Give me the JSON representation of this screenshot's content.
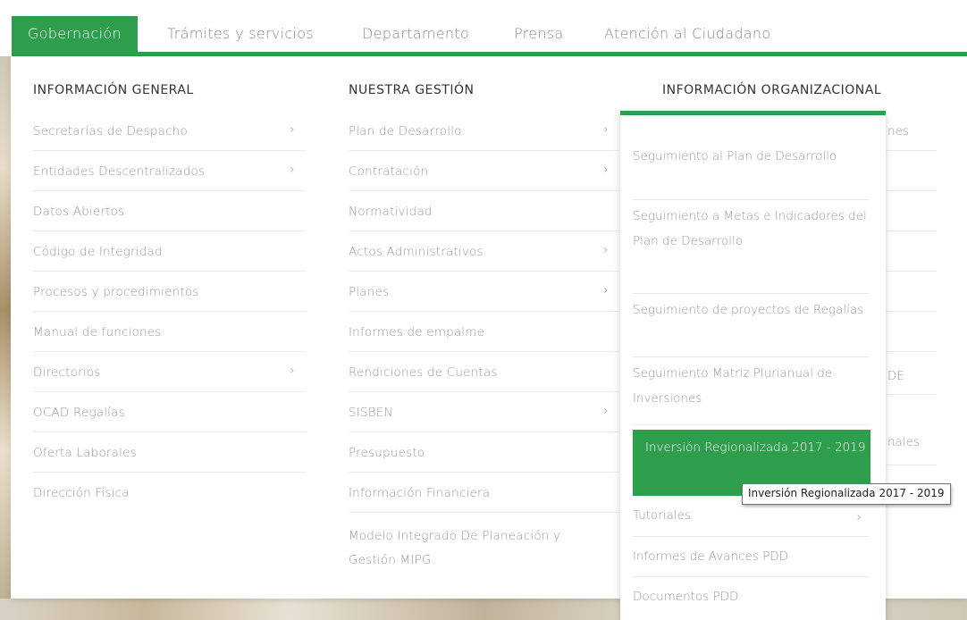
{
  "nav": {
    "items": [
      {
        "label": "Gobernación"
      },
      {
        "label": "Trámites y servicios"
      },
      {
        "label": "Departamento"
      },
      {
        "label": "Prensa"
      },
      {
        "label": "Atención al Ciudadano"
      }
    ]
  },
  "columns": [
    {
      "title": "INFORMACIÓN GENERAL",
      "items": [
        {
          "label": "Secretarías de Despacho",
          "chevron": "›"
        },
        {
          "label": "Entidades Descentralizados",
          "chevron": "›"
        },
        {
          "label": "Datos Abiertos"
        },
        {
          "label": "Código de Integridad"
        },
        {
          "label": "Procesos y procedimientos"
        },
        {
          "label": "Manual de funciones"
        },
        {
          "label": "Directorios",
          "chevron": "›"
        },
        {
          "label": "OCAD Regalías"
        },
        {
          "label": "Oferta Laborales"
        },
        {
          "label": "Dirección Física"
        }
      ]
    },
    {
      "title": "NUESTRA GESTIÓN",
      "items": [
        {
          "label": "Plan de Desarrollo",
          "chevron": "›"
        },
        {
          "label": "Contratación",
          "chevron": "›"
        },
        {
          "label": "Normatividad"
        },
        {
          "label": "Actos Administrativos",
          "chevron": "›"
        },
        {
          "label": "Planes",
          "chevron": "›"
        },
        {
          "label": "Informes de empalme"
        },
        {
          "label": "Rendiciones de Cuentas"
        },
        {
          "label": "SISBEN",
          "chevron": "›"
        },
        {
          "label": "Presupuesto"
        },
        {
          "label": "Información Financiera"
        },
        {
          "label": "Modelo Integrado De Planeación y Gestión MIPG."
        }
      ]
    },
    {
      "title": "INFORMACIÓN ORGANIZACIONAL",
      "peek": [
        "nes",
        "DE",
        "nales"
      ]
    }
  ],
  "flyout": {
    "items": [
      {
        "label": "Seguimiento al Plan de Desarrollo"
      },
      {
        "label": "Seguimiento a Metas e Indicadores del Plan de Desarrollo"
      },
      {
        "label": "Seguimiento de proyectos de Regalías"
      },
      {
        "label": "Seguimiento Matriz Plurianual de Inversiones"
      },
      {
        "label": "Inversión Regionalizada 2017 - 2019"
      },
      {
        "label": "Tutoriales",
        "chevron": "›"
      },
      {
        "label": "Informes de Avances PDD"
      },
      {
        "label": "Documentos PDD"
      }
    ]
  },
  "tooltip": {
    "text": "Inversión Regionalizada 2017 - 2019"
  },
  "colors": {
    "accent": "#2e9e4d",
    "text_muted": "#9a9a9a",
    "heading": "#333333"
  }
}
